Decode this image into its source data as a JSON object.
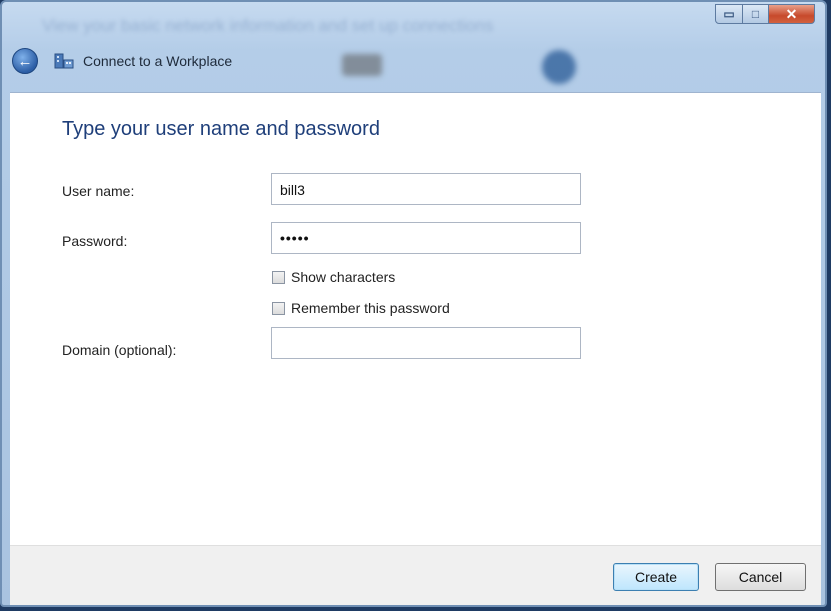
{
  "window": {
    "background_caption": "View your basic network information and set up connections",
    "title": "Connect to a Workplace",
    "controls": {
      "minimize": "▭",
      "maximize": "□",
      "close": "✕"
    }
  },
  "form": {
    "heading": "Type your user name and password",
    "username_label": "User name:",
    "username_value": "bill3",
    "password_label": "Password:",
    "password_value": "•••••",
    "show_characters_label": "Show characters",
    "remember_password_label": "Remember this password",
    "domain_label": "Domain (optional):",
    "domain_value": ""
  },
  "footer": {
    "create_label": "Create",
    "cancel_label": "Cancel"
  },
  "icons": {
    "back": "back-arrow-icon",
    "app": "network-workplace-icon"
  }
}
